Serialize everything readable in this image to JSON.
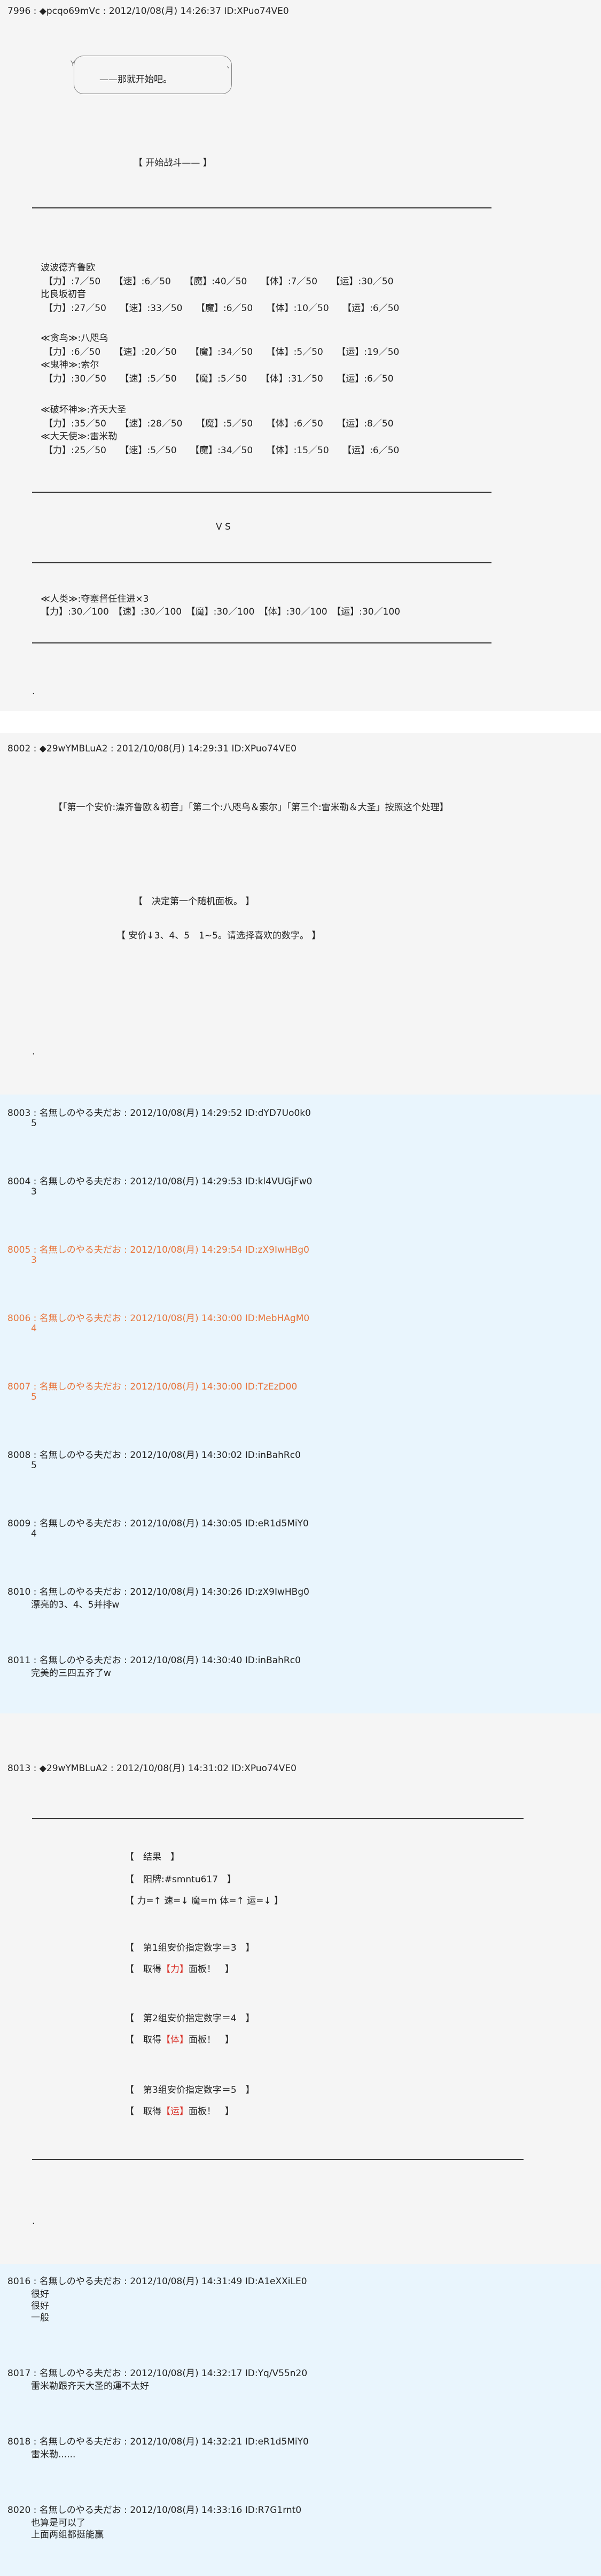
{
  "posts": {
    "p7996": {
      "header": "7996 : ◆pcqo69mVc : 2012/10/08(月) 14:26:37 ID:XPuo74VE0",
      "bubble_text": "——那就开始吧。",
      "bubble_mark_left": "Y",
      "bubble_mark_right": "、",
      "start_battle": "【 开始战斗—— 】",
      "team_a_1_name": "波波德齐鲁欧",
      "team_a_1_stats": "【力】:7／50　　【速】:6／50　　【魔】:40／50　　【体】:7／50　　【运】:30／50",
      "team_a_2_name": "比良坂初音",
      "team_a_2_stats": "【力】:27／50　　【速】:33／50　　【魔】:6／50　　【体】:10／50　　【运】:6／50",
      "team_b_1_name": "≪贪鸟≫:八咫乌",
      "team_b_1_stats": "【力】:6／50　　【速】:20／50　　【魔】:34／50　　【体】:5／50　　【运】:19／50",
      "team_b_2_name": "≪鬼神≫:索尔",
      "team_b_2_stats": "【力】:30／50　　【速】:5／50　　【魔】:5／50　　【体】:31／50　　【运】:6／50",
      "team_c_1_name": "≪破坏神≫:齐天大圣",
      "team_c_1_stats": "【力】:35／50　　【速】:28／50　　【魔】:5／50　　【体】:6／50　　【运】:8／50",
      "team_c_2_name": "≪大天使≫:雷米勒",
      "team_c_2_stats": "【力】:25／50　　【速】:5／50　　【魔】:34／50　　【体】:15／50　　【运】:6／50",
      "vs": "V S",
      "enemy_name": "≪人类≫:夺塞督任住进×3",
      "enemy_stats": "【力】:30／100　【速】:30／100　【魔】:30／100　【体】:30／100　【运】:30／100",
      "dot": "."
    },
    "p8002": {
      "header": "8002 : ◆29wYMBLuA2 : 2012/10/08(月) 14:29:31 ID:XPuo74VE0",
      "order_line": "【「第一个安价:漂齐鲁欧＆初音」「第二个:八咫乌＆索尔」「第三个:雷米勒＆大圣」按照这个处理】",
      "decide_line": "【　决定第一个随机面板。 】",
      "anchor_line": "【 安价↓3、4、5　1~5。请选择喜欢的数字。 】",
      "dot": "."
    },
    "replies": [
      {
        "header": "8003 : 名無しのやる夫だお : 2012/10/08(月) 14:29:52 ID:dYD7Uo0k0",
        "lines": [
          "5"
        ],
        "orange": false
      },
      {
        "header": "8004 : 名無しのやる夫だお : 2012/10/08(月) 14:29:53 ID:kl4VUGjFw0",
        "lines": [
          "3"
        ],
        "orange": false
      },
      {
        "header": "8005 : 名無しのやる夫だお : 2012/10/08(月) 14:29:54 ID:zX9IwHBg0",
        "lines": [
          "3"
        ],
        "orange": true
      },
      {
        "header": "8006 : 名無しのやる夫だお : 2012/10/08(月) 14:30:00 ID:MebHAgM0",
        "lines": [
          "4"
        ],
        "orange": true
      },
      {
        "header": "8007 : 名無しのやる夫だお : 2012/10/08(月) 14:30:00 ID:TzEzD00",
        "lines": [
          "5"
        ],
        "orange": true
      },
      {
        "header": "8008 : 名無しのやる夫だお : 2012/10/08(月) 14:30:02 ID:inBahRc0",
        "lines": [
          "5"
        ],
        "orange": false
      },
      {
        "header": "8009 : 名無しのやる夫だお : 2012/10/08(月) 14:30:05 ID:eR1d5MiY0",
        "lines": [
          "4"
        ],
        "orange": false
      },
      {
        "header": "8010 : 名無しのやる夫だお : 2012/10/08(月) 14:30:26 ID:zX9IwHBg0",
        "lines": [
          "漂亮的3、4、5并排w"
        ],
        "orange": false
      },
      {
        "header": "8011 : 名無しのやる夫だお : 2012/10/08(月) 14:30:40 ID:inBahRc0",
        "lines": [
          "完美的三四五齐了w"
        ],
        "orange": false
      }
    ],
    "p8013": {
      "header": "8013 : ◆29wYMBLuA2 : 2012/10/08(月) 14:31:02 ID:XPuo74VE0",
      "result": "【　结果　】",
      "panel_pre": "【　阳牌:#smntu617　】",
      "panel_stats": "【 力=↑ 速=↓ 魔=m 体=↑ 运=↓ 】",
      "first_anchor": "【　第1组安价指定数字＝3　】",
      "first_take_a": "【　取得",
      "first_take_b": "【力】",
      "first_take_c": "面板！　】",
      "second_anchor": "【　第2组安价指定数字＝4　】",
      "second_take_a": "【　取得",
      "second_take_b": "【体】",
      "second_take_c": "面板！　】",
      "third_anchor": "【　第3组安价指定数字＝5　】",
      "third_take_a": "【　取得",
      "third_take_b": "【运】",
      "third_take_c": "面板！　】",
      "dot": "."
    },
    "replies2": [
      {
        "header": "8016 : 名無しのやる夫だお : 2012/10/08(月) 14:31:49 ID:A1eXXiLE0",
        "lines": [
          "很好",
          "很好",
          "一般"
        ]
      },
      {
        "header": "8017 : 名無しのやる夫だお : 2012/10/08(月) 14:32:17 ID:Yq/V55n20",
        "lines": [
          "雷米勒跟齐天大圣的運不太好"
        ]
      },
      {
        "header": "8018 : 名無しのやる夫だお : 2012/10/08(月) 14:32:21 ID:eR1d5MiY0",
        "lines": [
          "雷米勒......"
        ]
      },
      {
        "header": "8020 : 名無しのやる夫だお : 2012/10/08(月) 14:33:16 ID:R7G1rnt0",
        "lines": [
          "也算是可以了",
          "上面两组都挺能赢"
        ]
      }
    ]
  },
  "colors": {
    "op_bg": "#f5f5f5",
    "reply_bg": "#e9f5fd",
    "anchor_hit": "#e8743b",
    "highlight": "#d9342b"
  }
}
